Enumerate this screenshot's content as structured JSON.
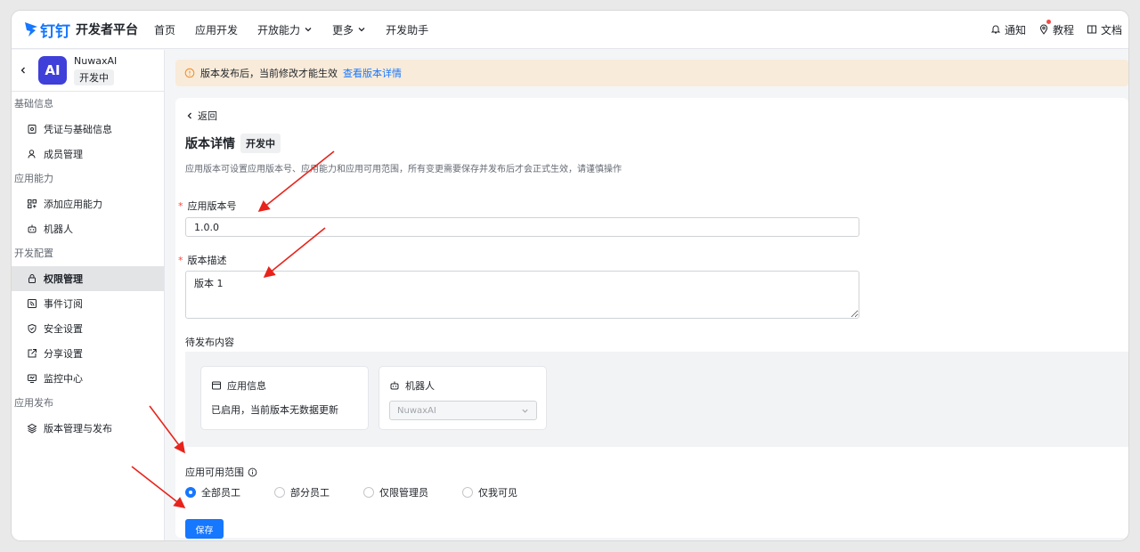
{
  "topnav": {
    "logo_mark": "钉钉",
    "logo_text": "开发者平台",
    "items": [
      {
        "label": "首页"
      },
      {
        "label": "应用开发"
      },
      {
        "label": "开放能力"
      },
      {
        "label": "更多"
      },
      {
        "label": "开发助手"
      }
    ],
    "right": {
      "notify": "通知",
      "tutorial": "教程",
      "docs": "文档"
    }
  },
  "app": {
    "icon_text": "AI",
    "name": "NuwaxAI",
    "status": "开发中",
    "icon_color": "#3f3fd9"
  },
  "sidebar": {
    "sections": [
      {
        "title": "基础信息",
        "items": [
          "凭证与基础信息",
          "成员管理"
        ]
      },
      {
        "title": "应用能力",
        "items": [
          "添加应用能力",
          "机器人"
        ]
      },
      {
        "title": "开发配置",
        "items": [
          "权限管理",
          "事件订阅",
          "安全设置",
          "分享设置",
          "监控中心"
        ]
      },
      {
        "title": "应用发布",
        "items": [
          "版本管理与发布"
        ]
      }
    ],
    "active": "权限管理"
  },
  "banner": {
    "text": "版本发布后，当前修改才能生效",
    "link": "查看版本详情"
  },
  "detail": {
    "back": "返回",
    "title": "版本详情",
    "badge": "开发中",
    "description": "应用版本可设置应用版本号、应用能力和应用可用范围，所有变更需要保存并发布后才会正式生效，请谨慎操作",
    "version_label": "应用版本号",
    "version_value": "1.0.0",
    "desc_label": "版本描述",
    "desc_value": "版本 1",
    "pending_label": "待发布内容",
    "app_info_title": "应用信息",
    "app_info_text": "已启用，当前版本无数据更新",
    "robot_title": "机器人",
    "robot_select": "NuwaxAI",
    "scope_label": "应用可用范围",
    "scope_options": [
      "全部员工",
      "部分员工",
      "仅限管理员",
      "仅我可见"
    ],
    "scope_selected": "全部员工",
    "save": "保存"
  },
  "colors": {
    "accent": "#1677ff",
    "annotation": "#e8231b",
    "banner_bg": "#f9ebd9"
  }
}
